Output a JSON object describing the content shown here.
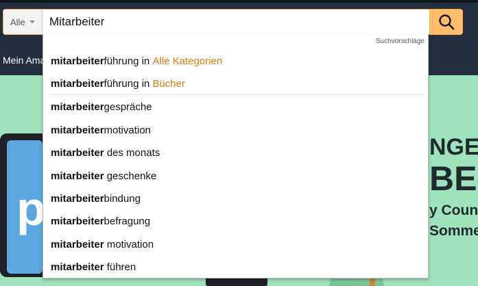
{
  "header": {
    "nav_partial": "Mein Amazon"
  },
  "search": {
    "scope_label": "Alle",
    "value": "Mitarbeiter",
    "button_icon": "search-icon"
  },
  "suggestions": {
    "header": "Suchvorschläge",
    "category_items": [
      {
        "bold": "mitarbeiter",
        "rest": "führung in ",
        "category": "Alle Kategorien"
      },
      {
        "bold": "mitarbeiter",
        "rest": "führung in ",
        "category": "Bücher"
      }
    ],
    "items": [
      {
        "bold": "mitarbeiter",
        "rest": "gespräche"
      },
      {
        "bold": "mitarbeiter",
        "rest": "motivation"
      },
      {
        "bold": "mitarbeiter",
        "rest": " des monats"
      },
      {
        "bold": "mitarbeiter",
        "rest": " geschenke"
      },
      {
        "bold": "mitarbeiter",
        "rest": "bindung"
      },
      {
        "bold": "mitarbeiter",
        "rest": "befragung"
      },
      {
        "bold": "mitarbeiter",
        "rest": " motivation"
      },
      {
        "bold": "mitarbeiter",
        "rest": " führen"
      }
    ]
  },
  "banner": {
    "tablet_letter": "p",
    "line1": "NGE",
    "line2": "BEI",
    "line3": "y Counte",
    "line4": "Sommer"
  },
  "colors": {
    "header_bg": "#232f3e",
    "search_accent": "#febd69",
    "category_link": "#e47911",
    "banner_bg": "#9fe3bd"
  }
}
